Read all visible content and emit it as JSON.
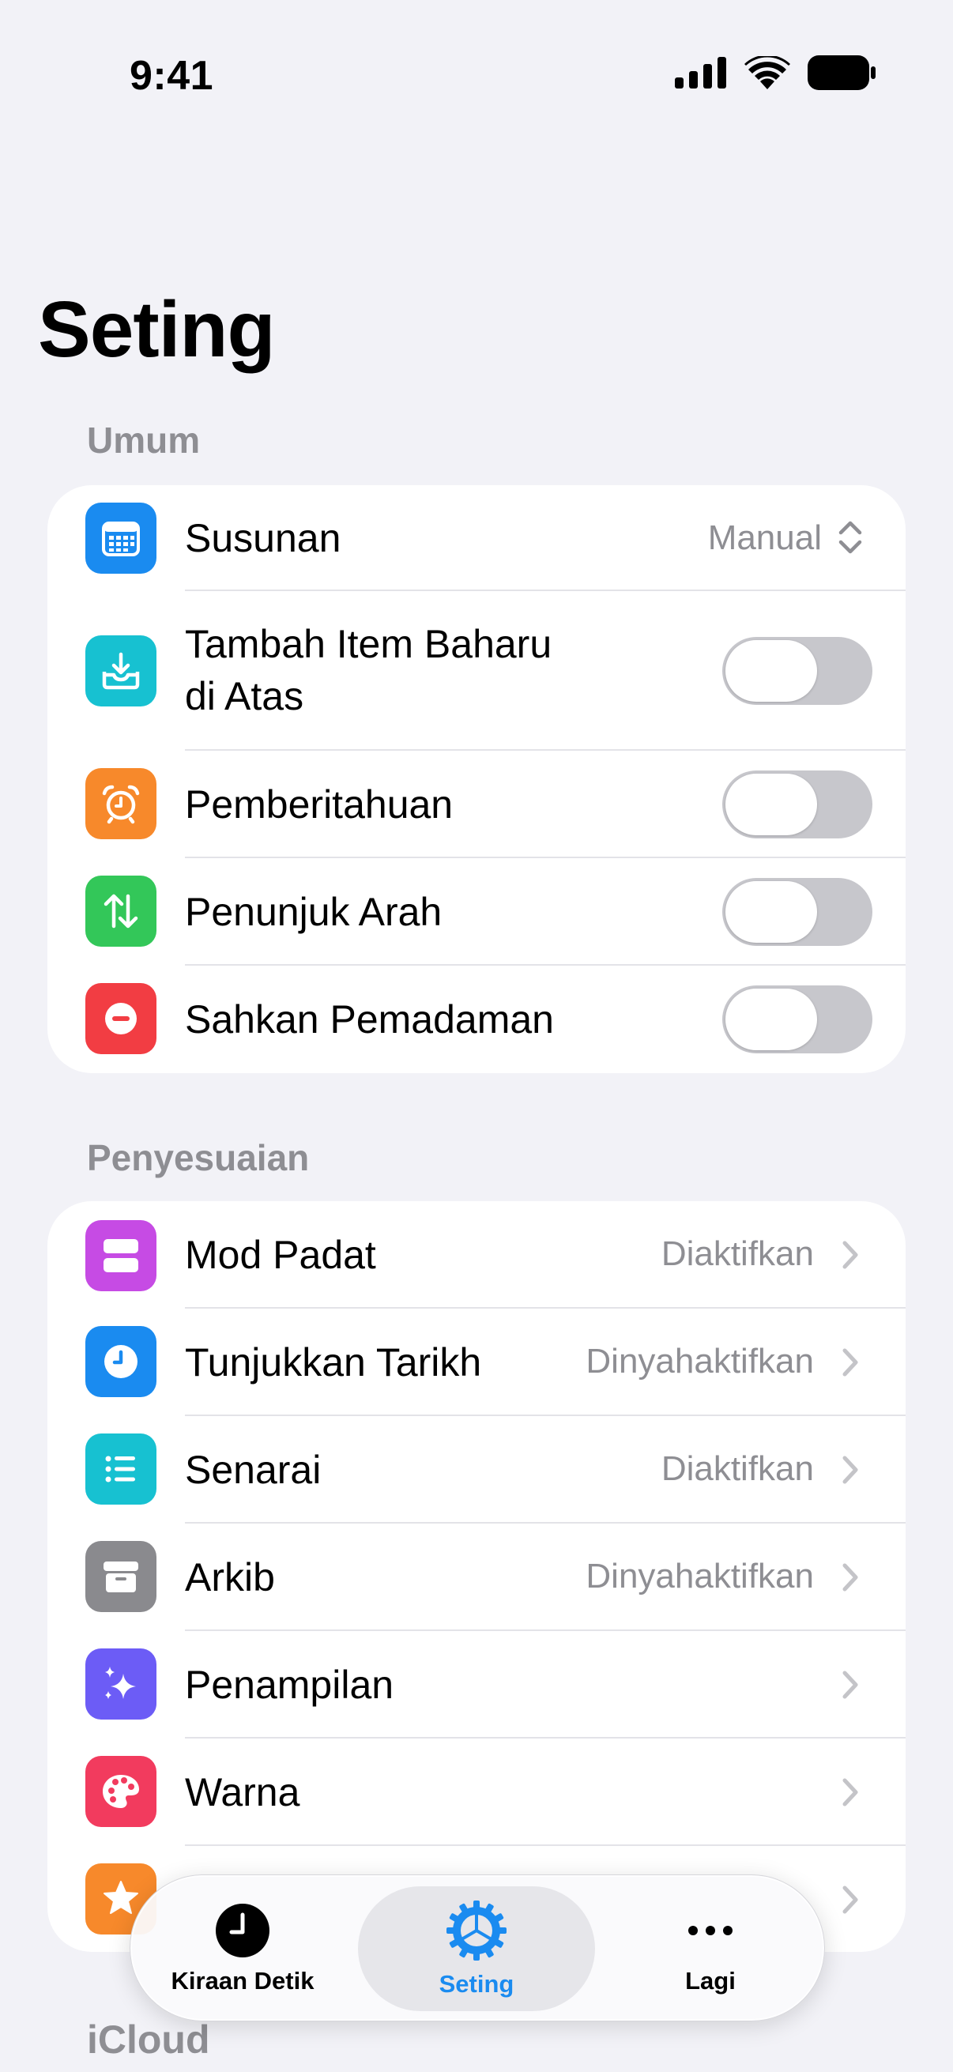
{
  "status_bar": {
    "time": "9:41"
  },
  "page": {
    "title": "Seting"
  },
  "sections": {
    "general": {
      "header": "Umum",
      "rows": [
        {
          "label": "Susunan",
          "value": "Manual",
          "icon": "calendar-grid-icon",
          "color": "#1A8BF0"
        },
        {
          "label_line1": "Tambah Item Baharu",
          "label_line2": "di Atas",
          "icon": "inbox-tray-download-icon",
          "color": "#17C1D1",
          "toggle": false
        },
        {
          "label": "Pemberitahuan",
          "icon": "alarm-clock-icon",
          "color": "#F7892B",
          "toggle": false
        },
        {
          "label": "Penunjuk Arah",
          "icon": "arrows-up-down-icon",
          "color": "#33C759",
          "toggle": false
        },
        {
          "label": "Sahkan Pemadaman",
          "icon": "minus-circle-icon",
          "color": "#F23D43",
          "toggle": false
        }
      ]
    },
    "customization": {
      "header": "Penyesuaian",
      "rows": [
        {
          "label": "Mod Padat",
          "value": "Diaktifkan",
          "icon": "stacked-rows-icon",
          "color": "#C64BE4"
        },
        {
          "label": "Tunjukkan Tarikh",
          "value": "Dinyahaktifkan",
          "icon": "clock-icon",
          "color": "#1A8BF0"
        },
        {
          "label": "Senarai",
          "value": "Diaktifkan",
          "icon": "list-icon",
          "color": "#17C1D1"
        },
        {
          "label": "Arkib",
          "value": "Dinyahaktifkan",
          "icon": "archive-box-icon",
          "color": "#8A8A8E"
        },
        {
          "label": "Penampilan",
          "icon": "sparkles-icon",
          "color": "#6C5CF6"
        },
        {
          "label": "Warna",
          "icon": "palette-icon",
          "color": "#F23B5E"
        },
        {
          "label": "",
          "icon": "star-icon",
          "color": "#F7892B"
        }
      ]
    },
    "icloud": {
      "header": "iCloud"
    }
  },
  "tab_bar": {
    "tabs": [
      {
        "label": "Kiraan Detik",
        "icon": "clock-icon"
      },
      {
        "label": "Seting",
        "icon": "gear-icon",
        "active": true
      },
      {
        "label": "Lagi",
        "icon": "more-ellipsis-icon"
      }
    ]
  }
}
